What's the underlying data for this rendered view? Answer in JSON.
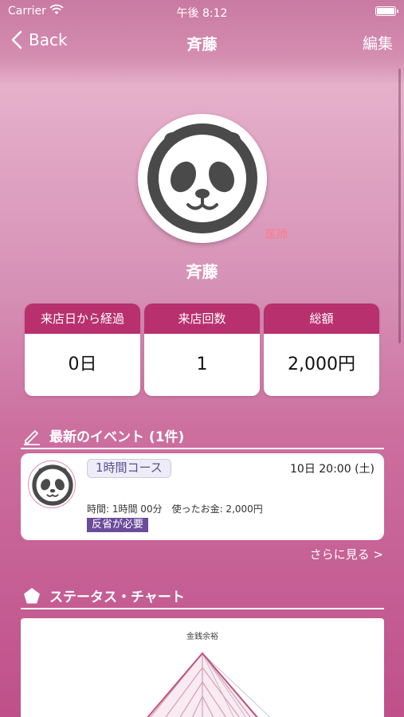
{
  "status": {
    "carrier": "Carrier",
    "time": "午後 8:12"
  },
  "nav": {
    "back_label": "Back",
    "title": "斉藤",
    "edit_label": "編集"
  },
  "profile": {
    "role": "医師",
    "name": "斉藤"
  },
  "stats": [
    {
      "label": "来店日から経過",
      "value": "0日"
    },
    {
      "label": "来店回数",
      "value": "1"
    },
    {
      "label": "総額",
      "value": "2,000円"
    }
  ],
  "events_section": {
    "title": "最新のイベント (1件)"
  },
  "event": {
    "course": "1時間コース",
    "date": "10日 20:00 (土)",
    "meta": "時間: 1時間 00分　使ったお金: 2,000円",
    "badge": "反省が必要"
  },
  "see_more": "さらに見る >",
  "chart_section": {
    "title": "ステータス・チャート"
  },
  "chart_data": {
    "type": "radar",
    "axis_labels": [
      "金銭余裕"
    ]
  },
  "colors": {
    "accent": "#b8306d",
    "badge": "#6b4b9a",
    "role": "#ff7a88"
  }
}
